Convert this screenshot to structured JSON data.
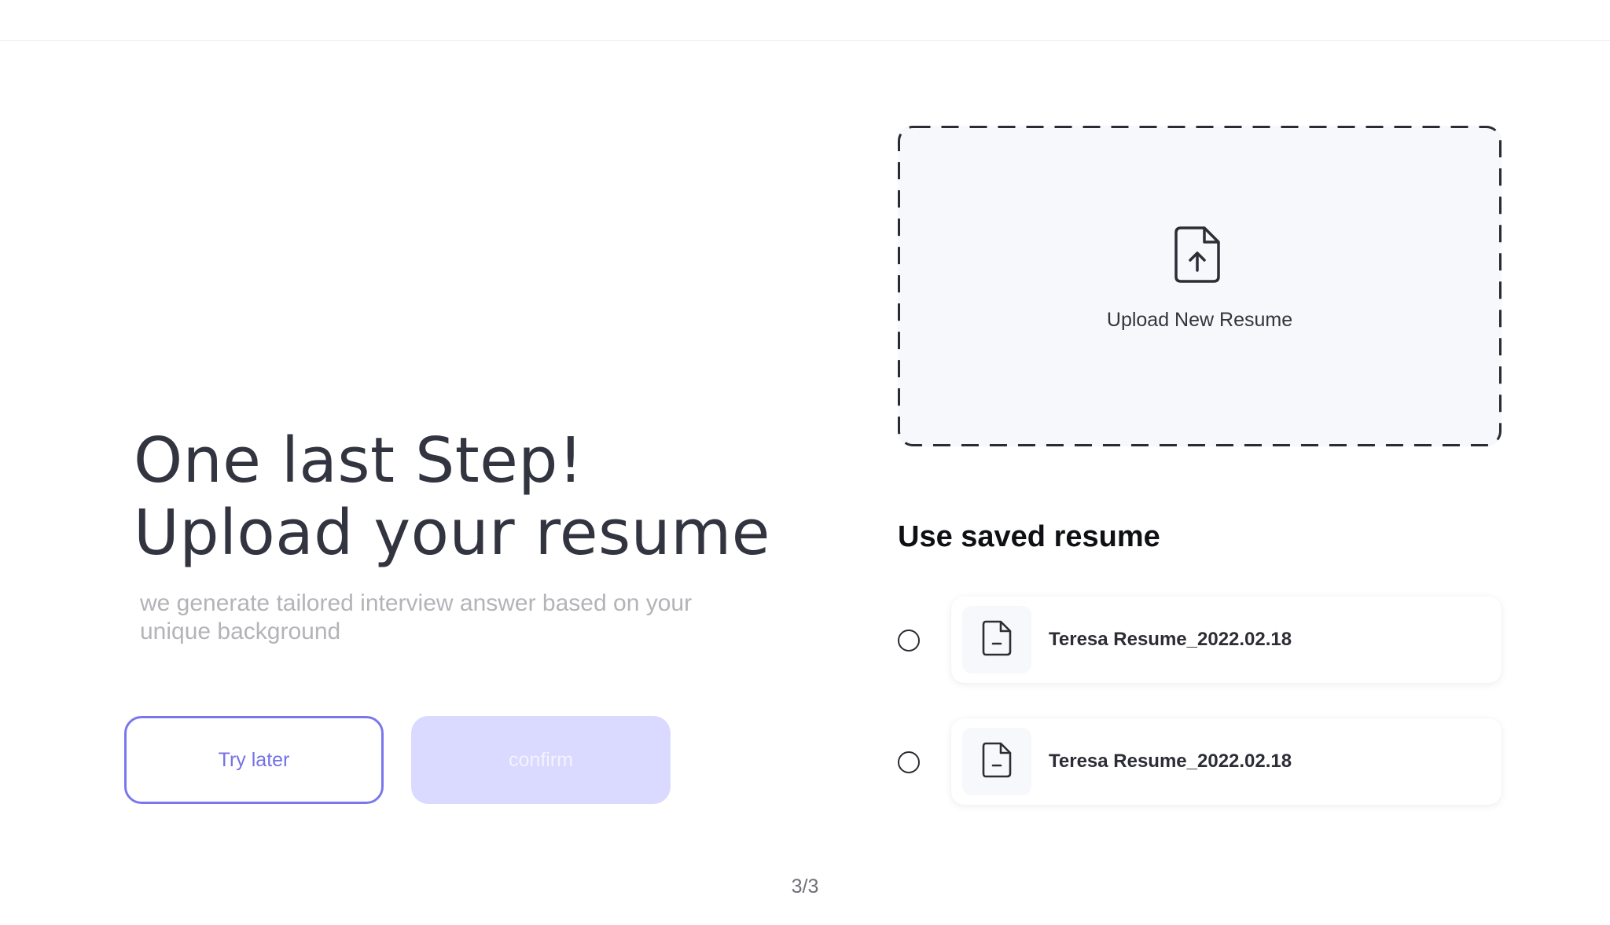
{
  "intro": {
    "title_line1": "One last Step!",
    "title_line2": "Upload your resume",
    "subtitle": "we generate tailored interview answer based on your unique background"
  },
  "actions": {
    "try_later_label": "Try later",
    "confirm_label": "confirm"
  },
  "pager": {
    "text": "3/3"
  },
  "upload": {
    "label": "Upload New Resume",
    "icon": "file-upload-icon"
  },
  "saved": {
    "title": "Use saved resume",
    "items": [
      {
        "name": "Teresa Resume_2022.02.18",
        "icon": "file-icon",
        "selected": false
      },
      {
        "name": "Teresa Resume_2022.02.18",
        "icon": "file-icon",
        "selected": false
      }
    ]
  },
  "colors": {
    "accent": "#7b76ee",
    "confirm_disabled_bg": "#dad9ff",
    "text_dark": "#32343f",
    "text_muted": "#b3b3b8",
    "upload_bg": "#f7f8fc"
  }
}
